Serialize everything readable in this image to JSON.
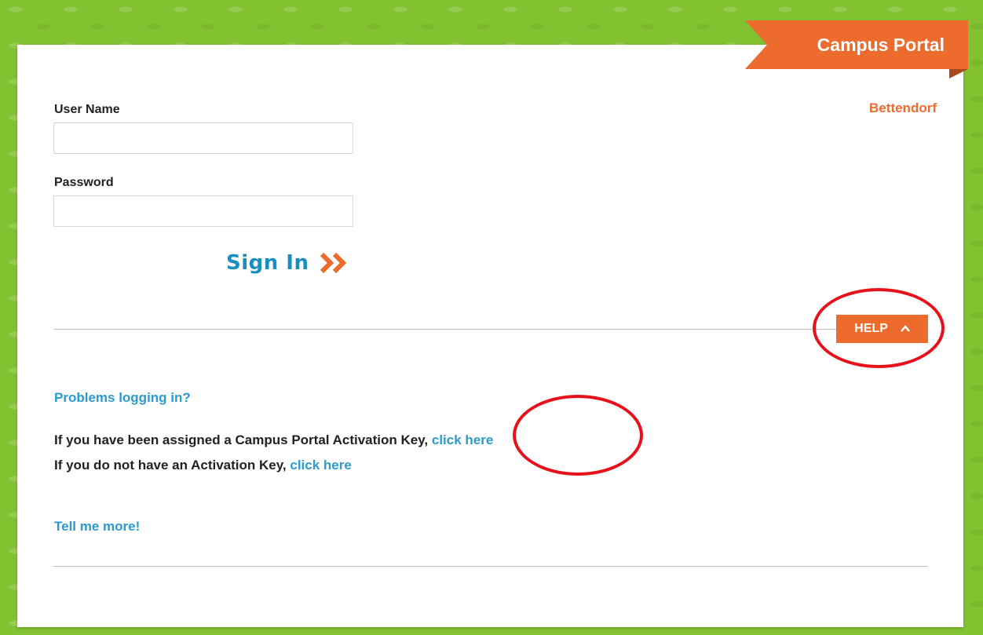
{
  "header": {
    "portal_label": "Campus Portal",
    "district": "Bettendorf"
  },
  "login": {
    "username_label": "User Name",
    "username_value": "",
    "password_label": "Password",
    "password_value": "",
    "signin_label": "Sign In"
  },
  "help": {
    "button_label": "HELP",
    "problems_link": "Problems logging in?",
    "activation_text": "If you have been assigned a Campus Portal Activation Key, ",
    "activation_link": "click here",
    "no_key_text": "If you do not have an Activation Key, ",
    "no_key_link": "click here",
    "tell_more_link": "Tell me more!"
  },
  "colors": {
    "accent": "#ec6b2d",
    "link": "#2b9bcf",
    "background": "#82c130",
    "annotation": "#e8111b"
  },
  "icons": {
    "signin_icon": "double-chevron-right-icon",
    "help_icon": "chevron-up-icon"
  }
}
